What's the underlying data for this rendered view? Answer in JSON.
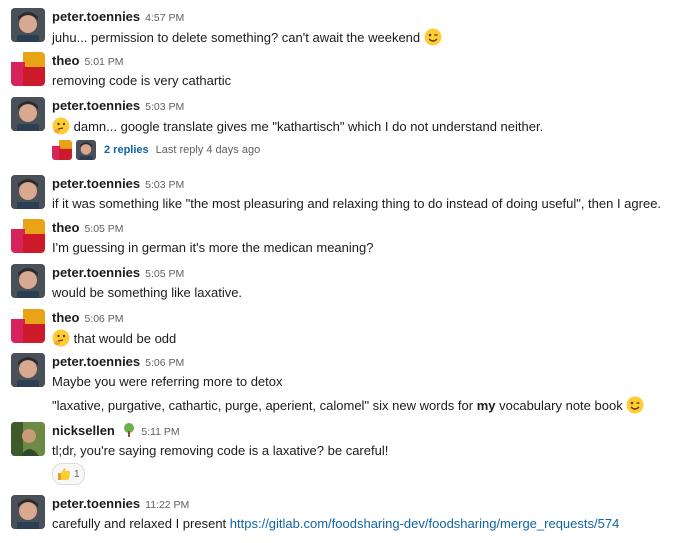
{
  "messages": [
    {
      "author": "peter.toennies",
      "time": "4:57 PM",
      "text": "juhu... permission to delete something? can't await the weekend",
      "emoji_end": "winking-face"
    },
    {
      "author": "theo",
      "time": "5:01 PM",
      "text": "removing code is very cathartic"
    },
    {
      "author": "peter.toennies",
      "time": "5:03 PM",
      "text": "damn... google translate gives me \"kathartisch\" which I do not understand neither.",
      "emoji_start": "thinking-face"
    },
    {
      "author": "peter.toennies",
      "time": "5:03 PM",
      "text": "if it was something like \"the most pleasuring and relaxing thing to do instead of doing useful\", then I agree."
    },
    {
      "author": "theo",
      "time": "5:05 PM",
      "text": "I'm guessing in german it's more the medican meaning?"
    },
    {
      "author": "peter.toennies",
      "time": "5:05 PM",
      "text": "would be something like laxative."
    },
    {
      "author": "theo",
      "time": "5:06 PM",
      "text": "that would be odd",
      "emoji_start": "thinking-face"
    },
    {
      "author": "peter.toennies",
      "time": "5:06 PM",
      "text": "Maybe you were referring more to detox",
      "text2_pre": "\"laxative, purgative, cathartic, purge, aperient, calomel\" six new words for ",
      "text2_bold": "my",
      "text2_post": " vocabulary note book",
      "emoji_end": "winking-face"
    },
    {
      "author": "nicksellen",
      "time": "5:11 PM",
      "text": "tl;dr, you're saying removing code is a laxative? be careful!",
      "status_emoji": "tree-icon"
    },
    {
      "author": "peter.toennies",
      "time": "11:22 PM",
      "text": "carefully and relaxed I present ",
      "link": "https://gitlab.com/foodsharing-dev/foodsharing/merge_requests/574"
    }
  ],
  "thread": {
    "replies": "2 replies",
    "last_reply": "Last reply 4 days ago"
  },
  "reaction": {
    "emoji": "thumbs-up",
    "count": "1"
  },
  "colors": {
    "link": "#1264a3",
    "theo_orange": "#e8a317",
    "theo_red": "#cc1a2b",
    "emoji_yellow": "#ffcc33"
  }
}
